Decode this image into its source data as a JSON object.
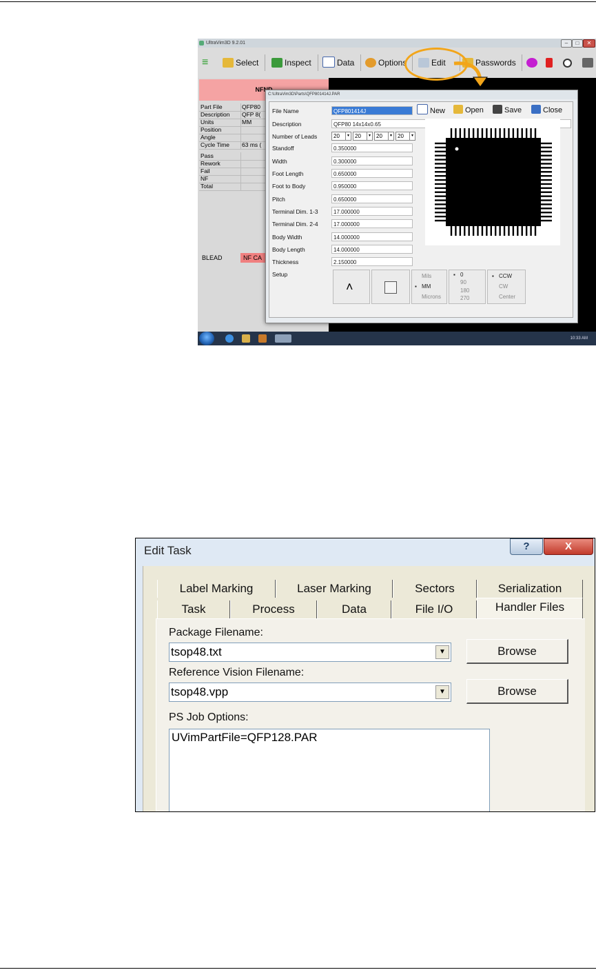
{
  "screenshot1": {
    "window_title": "UltraVim3D 9.2.01",
    "window_buttons": [
      "–",
      "□",
      "✕"
    ],
    "toolbar": [
      {
        "label": "",
        "icon": "wifi-icon"
      },
      {
        "label": "Select",
        "icon": "folder-icon"
      },
      {
        "label": "Inspect",
        "icon": "magnifier-icon"
      },
      {
        "label": "Data",
        "icon": "letter-a-icon"
      },
      {
        "label": "Options",
        "icon": "gear-icon"
      },
      {
        "label": "Edit",
        "icon": "pencil-icon"
      },
      {
        "label": "Passwords",
        "icon": "lock-icon"
      },
      {
        "label": "",
        "icon": "play-icon"
      },
      {
        "label": "",
        "icon": "stop-icon"
      },
      {
        "label": "",
        "icon": "zoom-icon"
      },
      {
        "label": "",
        "icon": "printer-icon"
      }
    ],
    "status": {
      "banner": "NFND",
      "rows": [
        {
          "k": "Part File",
          "v": "QFP80"
        },
        {
          "k": "Description",
          "v": "QFP 8("
        },
        {
          "k": "Units",
          "v": "MM"
        },
        {
          "k": "Position",
          "v": ""
        },
        {
          "k": "Angle",
          "v": ""
        },
        {
          "k": "Cycle Time",
          "v": "63 ms ("
        }
      ],
      "counts": [
        {
          "k": "Pass",
          "v": ""
        },
        {
          "k": "Rework",
          "v": ""
        },
        {
          "k": "Fail",
          "v": ""
        },
        {
          "k": "NF",
          "v": ""
        },
        {
          "k": "Total",
          "v": ""
        }
      ],
      "blead": {
        "k": "BLEAD",
        "v": "NF CA"
      }
    },
    "dialog": {
      "title": "C:\\UltraVim3D\\Parts\\QFP801414J.PAR",
      "file_name_label": "File Name",
      "file_name": "QFP801414J",
      "buttons": {
        "new": "New",
        "open": "Open",
        "save": "Save",
        "close": "Close"
      },
      "description_label": "Description",
      "description": "QFP80 14x14x0.65",
      "leads_label": "Number of Leads",
      "leads": [
        "20",
        "20",
        "20",
        "20"
      ],
      "params": [
        {
          "label": "Standoff",
          "value": "0.350000"
        },
        {
          "label": "Width",
          "value": "0.300000"
        },
        {
          "label": "Foot Length",
          "value": "0.650000"
        },
        {
          "label": "Foot to Body",
          "value": "0.950000"
        },
        {
          "label": "Pitch",
          "value": "0.650000"
        },
        {
          "label": "Terminal Dim. 1-3",
          "value": "17.000000"
        },
        {
          "label": "Terminal Dim. 2-4",
          "value": "17.000000"
        },
        {
          "label": "Body Width",
          "value": "14.000000"
        },
        {
          "label": "Body Length",
          "value": "14.000000"
        },
        {
          "label": "Thickness",
          "value": "2.150000"
        }
      ],
      "setup_label": "Setup",
      "units": {
        "mils": "Mils",
        "mm": "MM",
        "microns": "Microns",
        "selected": "MM"
      },
      "rotation": {
        "r0": "0",
        "r90": "90",
        "r180": "180",
        "r270": "270",
        "selected": "0"
      },
      "direction": {
        "ccw": "CCW",
        "cw": "CW",
        "center": "Center",
        "selected": "CCW"
      }
    },
    "taskbar": {
      "clock": "10:33 AM"
    }
  },
  "screenshot2": {
    "title": "Edit Task",
    "help_glyph": "?",
    "close_glyph": "X",
    "tabs_back": [
      "Label Marking",
      "Laser Marking",
      "Sectors",
      "Serialization"
    ],
    "tabs_front": [
      "Task",
      "Process",
      "Data",
      "File I/O",
      "Handler Files"
    ],
    "active_tab": "Handler Files",
    "package_label": "Package Filename:",
    "package_value": "tsop48.txt",
    "browse1": "Browse",
    "ref_label": "Reference Vision Filename:",
    "ref_value": "tsop48.vpp",
    "browse2": "Browse",
    "ps_label": "PS Job Options:",
    "ps_value": "UVimPartFile=QFP128.PAR"
  },
  "colors": {
    "nfnd": "#f5a3a3",
    "blead": "#f08080",
    "annotation": "#f2a51a",
    "selection": "#3a7bd5"
  }
}
